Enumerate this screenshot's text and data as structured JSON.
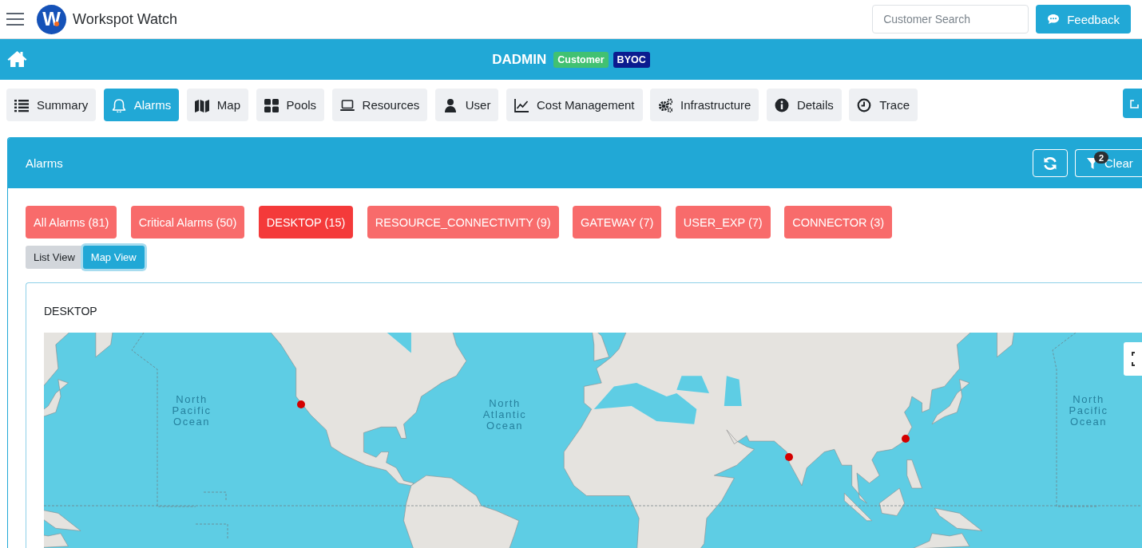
{
  "app": {
    "logo_letter": "W",
    "title": "Workspot Watch",
    "search": {
      "placeholder": "Customer Search"
    },
    "feedback": "Feedback"
  },
  "banner": {
    "name": "DADMIN",
    "badges": [
      {
        "label": "Customer",
        "kind": "customer"
      },
      {
        "label": "BYOC",
        "kind": "plan"
      }
    ]
  },
  "tabs": [
    {
      "label": "Summary",
      "selected": false
    },
    {
      "label": "Alarms",
      "selected": true
    },
    {
      "label": "Map",
      "selected": false
    },
    {
      "label": "Pools",
      "selected": false
    },
    {
      "label": "Resources",
      "selected": false
    },
    {
      "label": "User",
      "selected": false
    },
    {
      "label": "Cost Management",
      "selected": false
    },
    {
      "label": "Infrastructure",
      "selected": false
    },
    {
      "label": "Details",
      "selected": false
    },
    {
      "label": "Trace",
      "selected": false
    }
  ],
  "alarms": {
    "title": "Alarms",
    "filter_count": "2",
    "clear": "Clear",
    "categories": [
      {
        "label": "All Alarms (81)",
        "selected": false
      },
      {
        "label": "Critical Alarms (50)",
        "selected": false
      },
      {
        "label": "DESKTOP (15)",
        "selected": true
      },
      {
        "label": "RESOURCE_CONNECTIVITY (9)",
        "selected": false
      },
      {
        "label": "GATEWAY (7)",
        "selected": false
      },
      {
        "label": "USER_EXP (7)",
        "selected": false
      },
      {
        "label": "CONNECTOR (3)",
        "selected": false
      }
    ],
    "views": [
      {
        "label": "List View",
        "selected": false
      },
      {
        "label": "Map View",
        "selected": true
      }
    ],
    "map": {
      "title": "DESKTOP",
      "ocean_labels": [
        "North Pacific Ocean",
        "North Atlantic Ocean",
        "North Pacific Ocean"
      ]
    }
  }
}
